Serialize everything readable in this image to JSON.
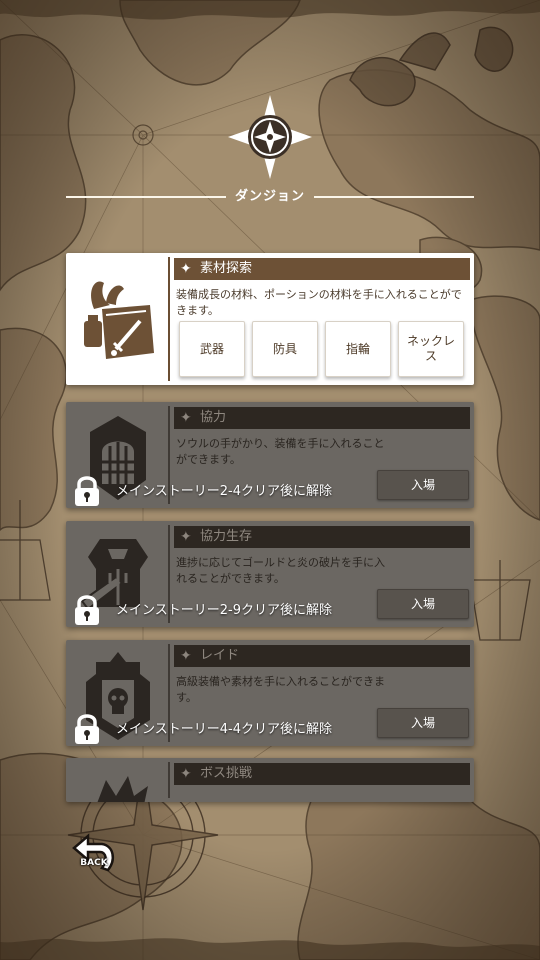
{
  "header": {
    "title": "ダンジョン"
  },
  "dungeons": [
    {
      "title": "素材探索",
      "description": "装備成長の材料、ポーションの材料を手に入れることができます。",
      "icon": "materials-book-sword-icon",
      "locked": false,
      "buttons": [
        "武器",
        "防具",
        "指輪",
        "ネックレス"
      ]
    },
    {
      "title": "協力",
      "description": "ソウルの手がかり、装備を手に入れることができます。",
      "icon": "gate-shield-icon",
      "locked": true,
      "unlock_condition": "メインストーリー2-4クリア後に解除",
      "enter_label": "入場"
    },
    {
      "title": "協力生存",
      "description": "進捗に応じてゴールドと炎の破片を手に入れることができます。",
      "icon": "armor-trident-icon",
      "locked": true,
      "unlock_condition": "メインストーリー2-9クリア後に解除",
      "enter_label": "入場"
    },
    {
      "title": "レイド",
      "description": "高級装備や素材を手に入れることができます。",
      "icon": "skull-banner-icon",
      "locked": true,
      "unlock_condition": "メインストーリー4-4クリア後に解除",
      "enter_label": "入場"
    },
    {
      "title": "ボス挑戦",
      "icon": "dragon-boss-icon",
      "locked": true
    }
  ],
  "back": {
    "label": "BACK"
  },
  "colors": {
    "map_paper": "#a89274",
    "active_header": "#6d5136",
    "locked_card": "#6b6762",
    "locked_header": "#2d2721"
  }
}
